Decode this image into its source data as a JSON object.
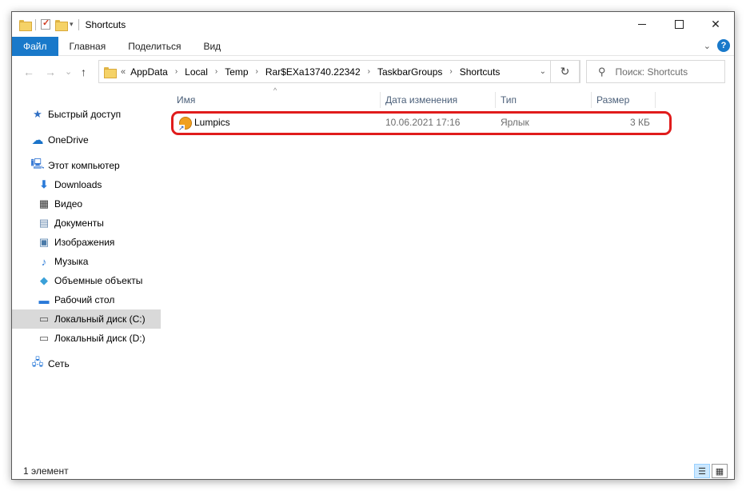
{
  "window": {
    "title": "Shortcuts",
    "close_glyph": "✕"
  },
  "ribbon": {
    "tabs": [
      "Файл",
      "Главная",
      "Поделиться",
      "Вид"
    ],
    "help_glyph": "?"
  },
  "navbar": {
    "back_glyph": "←",
    "forward_glyph": "→",
    "recent_glyph": "⌄",
    "up_glyph": "↑",
    "overflow": "«",
    "breadcrumbs": [
      "AppData",
      "Local",
      "Temp",
      "Rar$EXa13740.22342",
      "TaskbarGroups",
      "Shortcuts"
    ],
    "refresh_glyph": "↻",
    "search_placeholder": "Поиск: Shortcuts"
  },
  "sidebar": {
    "items": [
      {
        "label": "Быстрый доступ",
        "icon": "star-icon"
      },
      {
        "label": "OneDrive",
        "icon": "cloud-icon"
      },
      {
        "label": "Этот компьютер",
        "icon": "computer-icon"
      },
      {
        "label": "Downloads",
        "icon": "download-arrow-icon"
      },
      {
        "label": "Видео",
        "icon": "film-icon"
      },
      {
        "label": "Документы",
        "icon": "document-icon"
      },
      {
        "label": "Изображения",
        "icon": "image-icon"
      },
      {
        "label": "Музыка",
        "icon": "music-note-icon"
      },
      {
        "label": "Объемные объекты",
        "icon": "cube-icon"
      },
      {
        "label": "Рабочий стол",
        "icon": "desktop-icon"
      },
      {
        "label": "Локальный диск (C:)",
        "icon": "drive-icon"
      },
      {
        "label": "Локальный диск (D:)",
        "icon": "drive-icon"
      },
      {
        "label": "Сеть",
        "icon": "network-icon"
      }
    ]
  },
  "columns": {
    "name": "Имя",
    "date": "Дата изменения",
    "type": "Тип",
    "size": "Размер"
  },
  "files": [
    {
      "name": "Lumpics",
      "date": "10.06.2021 17:16",
      "type": "Ярлык",
      "size": "3 КБ",
      "icon": "shortcut-icon"
    }
  ],
  "status": {
    "count_text": "1 элемент"
  },
  "colors": {
    "accent": "#1979ca",
    "highlight_border": "#e01c1c",
    "selected_bg": "#d9d9d9"
  }
}
